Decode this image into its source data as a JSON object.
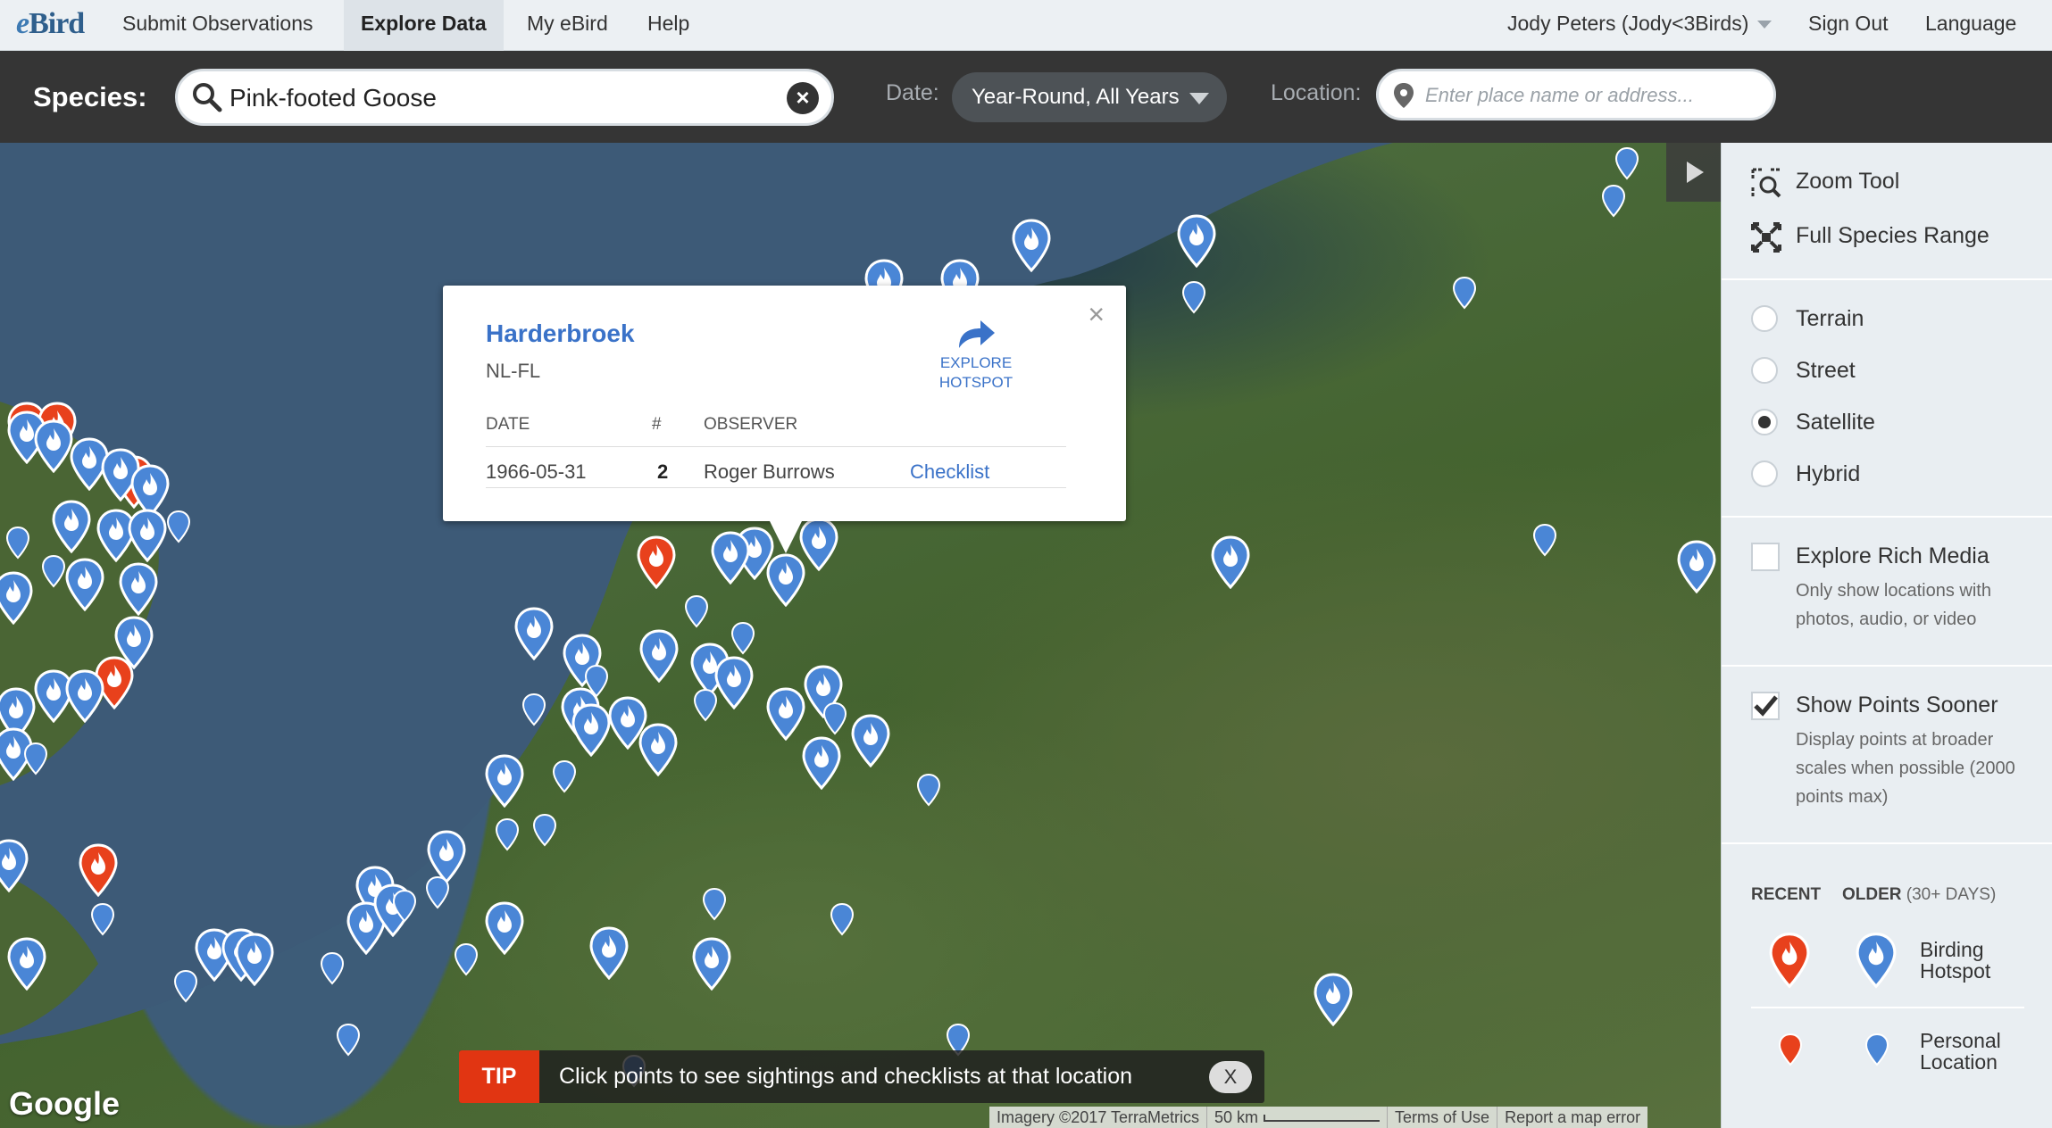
{
  "nav": {
    "logo_e": "e",
    "logo_rest": "Bird",
    "items": [
      {
        "label": "Submit Observations"
      },
      {
        "label": "Explore Data"
      },
      {
        "label": "My eBird"
      },
      {
        "label": "Help"
      }
    ],
    "user": "Jody Peters (Jody<3Birds)",
    "sign_out": "Sign Out",
    "language": "Language"
  },
  "search": {
    "species_label": "Species:",
    "species_value": "Pink-footed Goose",
    "date_label": "Date:",
    "date_value": "Year-Round, All Years",
    "location_label": "Location:",
    "location_placeholder": "Enter place name or address..."
  },
  "popup": {
    "title": "Harderbroek",
    "code": "NL-FL",
    "explore_line1": "EXPLORE",
    "explore_line2": "HOTSPOT",
    "columns": [
      "DATE",
      "#",
      "OBSERVER"
    ],
    "rows": [
      {
        "date": "1966-05-31",
        "count": "2",
        "observer": "Roger Burrows",
        "link": "Checklist"
      }
    ],
    "close": "×"
  },
  "tip": {
    "badge": "TIP",
    "message": "Click points to see sightings and checklists at that location",
    "close": "X"
  },
  "map": {
    "google": "Google",
    "imagery": "Imagery ©2017 TerraMetrics",
    "scale": "50 km",
    "terms": "Terms of Use",
    "report": "Report a map error",
    "colors": {
      "recent": "#e8411c",
      "older": "#4a86d6"
    }
  },
  "panel": {
    "zoom_tool": "Zoom Tool",
    "full_range": "Full Species Range",
    "map_types": [
      {
        "label": "Terrain",
        "selected": false
      },
      {
        "label": "Street",
        "selected": false
      },
      {
        "label": "Satellite",
        "selected": true
      },
      {
        "label": "Hybrid",
        "selected": false
      }
    ],
    "rich_media": {
      "label": "Explore Rich Media",
      "sub": "Only show locations with photos, audio, or video",
      "checked": false
    },
    "points_sooner": {
      "label": "Show Points Sooner",
      "sub": "Display points at broader scales when possible (2000 points max)",
      "checked": true
    },
    "legend": {
      "recent": "RECENT",
      "older": "OLDER",
      "older_note": "(30+ DAYS)",
      "hotspot_line1": "Birding",
      "hotspot_line2": "Hotspot",
      "personal_line1": "Personal",
      "personal_line2": "Location"
    }
  }
}
